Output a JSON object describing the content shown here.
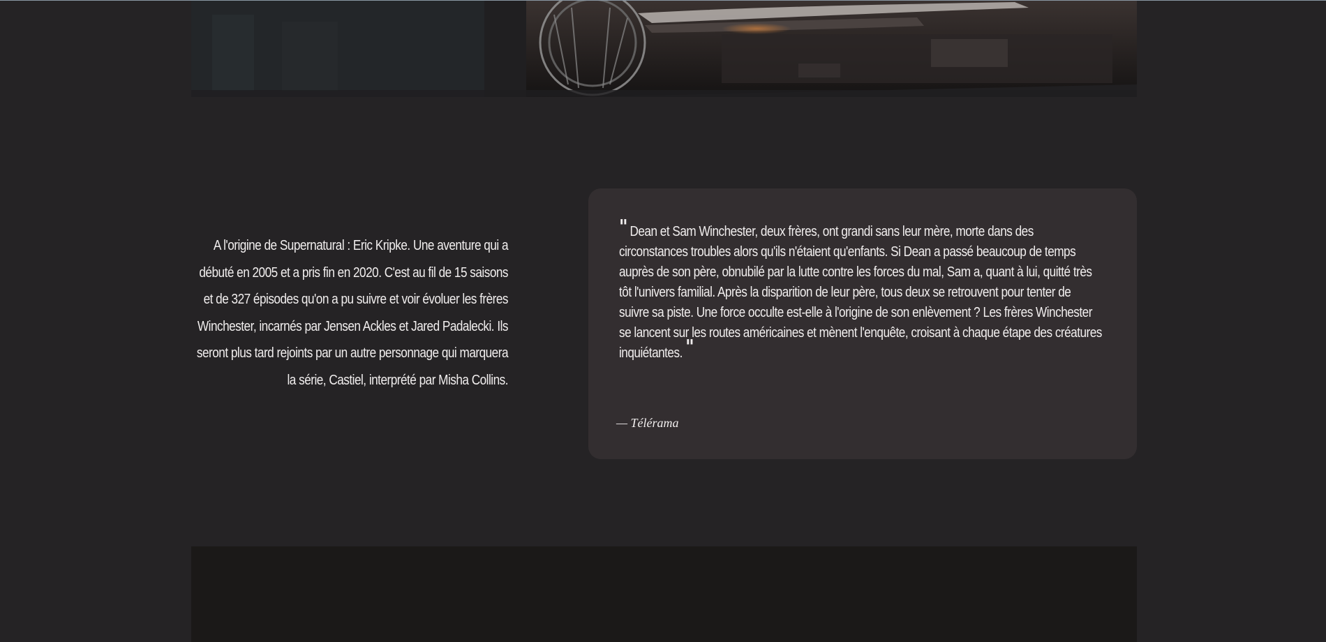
{
  "hero": {
    "image": "black-car-front-photo"
  },
  "intro": {
    "text": "A l'origine de Supernatural : Eric Kripke. Une aventure qui a débuté en 2005 et a pris fin en 2020. C'est au fil de 15 saisons et de 327 épisodes qu'on a pu suivre et voir évoluer les frères Winchester, incarnés par Jensen Ackles et Jared Padalecki. Ils seront plus tard rejoints par un autre personnage qui marquera la série, Castiel, interprété par Misha Collins."
  },
  "quote": {
    "open_mark": "\"",
    "text": "Dean et Sam Winchester, deux frères, ont grandi sans leur mère, morte dans des circonstances troubles alors qu'ils n'étaient qu'enfants. Si Dean a passé beaucoup de temps auprès de son père, obnubilé par la lutte contre les forces du mal, Sam a, quant à lui, quitté très tôt l'univers familial. Après la disparition de leur père, tous deux se retrouvent pour tenter de suivre sa piste. Une force occulte est-elle à l'origine de son enlèvement ? Les frères Winchester se lancent sur les routes américaines et mènent l'enquête, croisant à chaque étape des créatures inquiétantes.",
    "close_mark": "\"",
    "attribution": "— Télérama"
  },
  "colors": {
    "page_bg": "#252325",
    "card_bg": "#332e30",
    "text": "#f1eeee",
    "bottom_block": "#1b1918"
  }
}
